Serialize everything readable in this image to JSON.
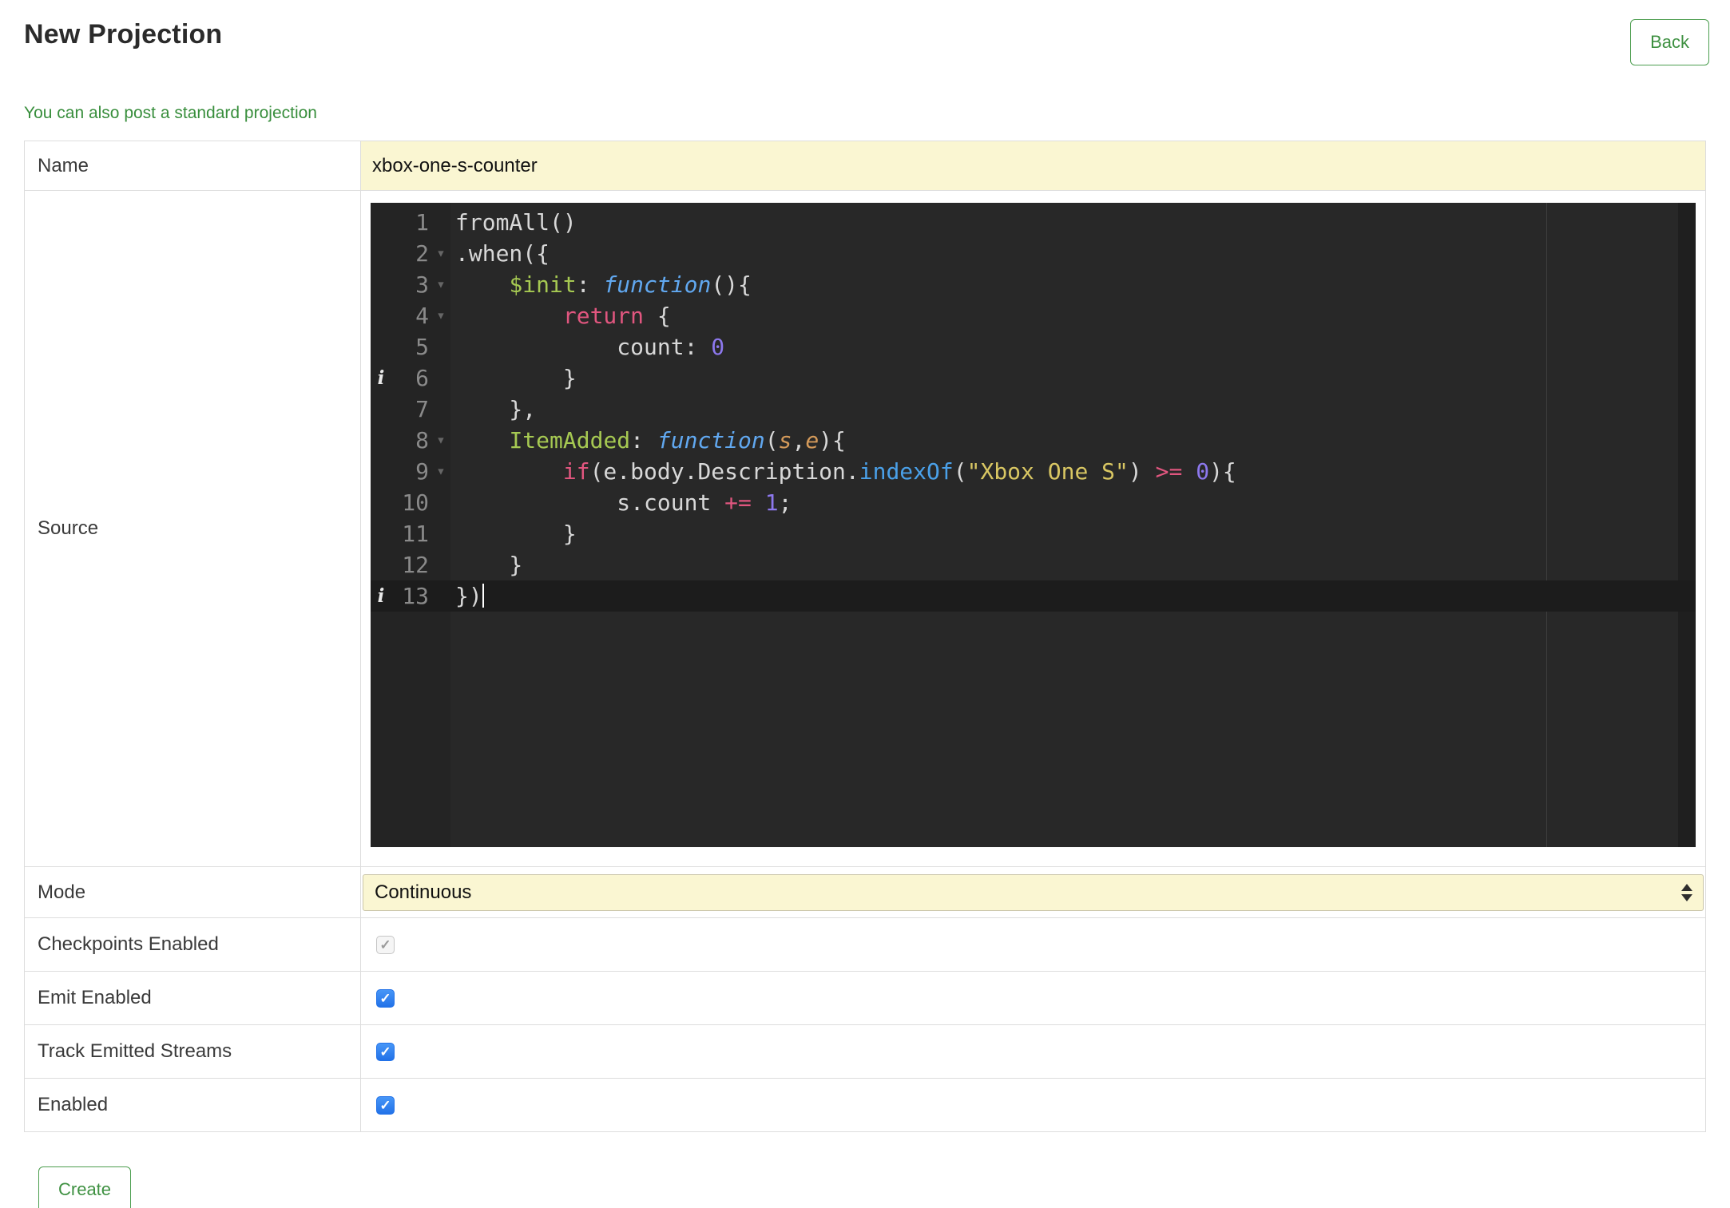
{
  "header": {
    "title": "New Projection",
    "back_button": "Back"
  },
  "intro_link": "You can also post a standard projection",
  "form": {
    "name": {
      "label": "Name",
      "value": "xbox-one-s-counter"
    },
    "source": {
      "label": "Source"
    },
    "mode": {
      "label": "Mode",
      "selected": "Continuous"
    },
    "checkpoints": {
      "label": "Checkpoints Enabled",
      "checked": true,
      "disabled": true
    },
    "emit": {
      "label": "Emit Enabled",
      "checked": true,
      "disabled": false
    },
    "track": {
      "label": "Track Emitted Streams",
      "checked": true,
      "disabled": false
    },
    "enabled": {
      "label": "Enabled",
      "checked": true,
      "disabled": false
    }
  },
  "create_button": "Create",
  "icons": {
    "check": "✓",
    "fold_open": "▾",
    "lint_info": "i"
  },
  "colors": {
    "accent_green": "#3f9142",
    "highlight_yellow": "#faf6d2",
    "checkbox_blue": "#2272e8",
    "editor_background": "#282828",
    "active_line": "#1c1c1c"
  },
  "editor": {
    "lines": [
      {
        "n": "1",
        "tokens": [
          [
            "p",
            "fromAll()"
          ]
        ]
      },
      {
        "n": "2",
        "fold": true,
        "tokens": [
          [
            "p",
            ".when({"
          ]
        ]
      },
      {
        "n": "3",
        "fold": true,
        "tokens": [
          [
            "p",
            "    "
          ],
          [
            "prop",
            "$init"
          ],
          [
            "p",
            ": "
          ],
          [
            "fn",
            "function"
          ],
          [
            "p",
            "(){"
          ]
        ]
      },
      {
        "n": "4",
        "fold": true,
        "tokens": [
          [
            "p",
            "        "
          ],
          [
            "k",
            "return"
          ],
          [
            "p",
            " {"
          ]
        ]
      },
      {
        "n": "5",
        "tokens": [
          [
            "p",
            "            count: "
          ],
          [
            "num",
            "0"
          ]
        ]
      },
      {
        "n": "6",
        "info": true,
        "tokens": [
          [
            "p",
            "        }"
          ]
        ]
      },
      {
        "n": "7",
        "tokens": [
          [
            "p",
            "    },"
          ]
        ]
      },
      {
        "n": "8",
        "fold": true,
        "tokens": [
          [
            "p",
            "    "
          ],
          [
            "prop",
            "ItemAdded"
          ],
          [
            "p",
            ": "
          ],
          [
            "fn",
            "function"
          ],
          [
            "p",
            "("
          ],
          [
            "param",
            "s"
          ],
          [
            "p",
            ","
          ],
          [
            "param",
            "e"
          ],
          [
            "p",
            "){"
          ]
        ]
      },
      {
        "n": "9",
        "fold": true,
        "tokens": [
          [
            "p",
            "        "
          ],
          [
            "k",
            "if"
          ],
          [
            "p",
            "(e.body.Description."
          ],
          [
            "b",
            "indexOf"
          ],
          [
            "p",
            "("
          ],
          [
            "str",
            "\"Xbox One S\""
          ],
          [
            "p",
            ") "
          ],
          [
            "k",
            ">="
          ],
          [
            "p",
            " "
          ],
          [
            "num",
            "0"
          ],
          [
            "p",
            "){"
          ]
        ]
      },
      {
        "n": "10",
        "tokens": [
          [
            "p",
            "            s.count "
          ],
          [
            "k",
            "+="
          ],
          [
            "p",
            " "
          ],
          [
            "num",
            "1"
          ],
          [
            "p",
            ";"
          ]
        ]
      },
      {
        "n": "11",
        "tokens": [
          [
            "p",
            "        }"
          ]
        ]
      },
      {
        "n": "12",
        "tokens": [
          [
            "p",
            "    }"
          ]
        ]
      },
      {
        "n": "13",
        "info": true,
        "active": true,
        "cursor": true,
        "tokens": [
          [
            "p",
            "})"
          ]
        ]
      }
    ]
  }
}
